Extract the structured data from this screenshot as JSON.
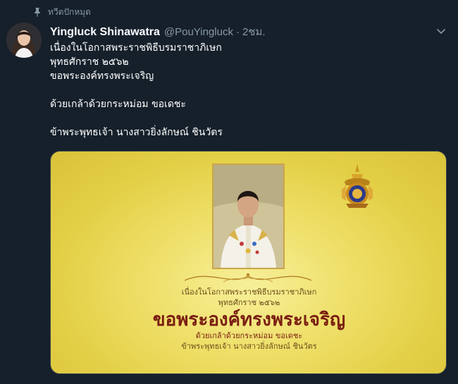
{
  "pinned_label": "ทวีตปักหมุด",
  "user": {
    "display_name": "Yingluck Shinawatra",
    "handle": "@PouYingluck",
    "separator": "·",
    "time": "2ชม."
  },
  "tweet_lines": [
    "เนื่องในโอกาสพระราชพิธีบรมราชาภิเษก",
    "พุทธศักราช ๒๕๖๒",
    "ขอพระองค์ทรงพระเจริญ",
    "",
    "ด้วยเกล้าด้วยกระหม่อม ขอเดชะ",
    "",
    "ข้าพระพุทธเจ้า นางสาวยิ่งลักษณ์ ชินวัตร"
  ],
  "media_card": {
    "line1": "เนื่องในโอกาสพระราชพิธีบรมราชาภิเษก",
    "line2": "พุทธศักราช ๒๕๖๒",
    "title": "ขอพระองค์ทรงพระเจริญ",
    "line3": "ด้วยเกล้าด้วยกระหม่อม ขอเดชะ",
    "line4": "ข้าพระพุทธเจ้า นางสาวยิ่งลักษณ์ ชินวัตร"
  },
  "colors": {
    "background": "#15202b",
    "secondary_text": "#8899a6",
    "card_gold": "#efe06a",
    "card_title_red": "#7a1e12"
  },
  "icons": {
    "pinned": "pin-icon",
    "menu": "chevron-down-icon"
  }
}
